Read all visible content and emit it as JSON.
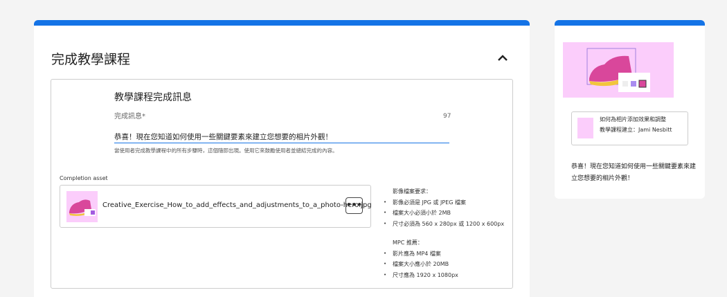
{
  "section": {
    "title": "完成教學課程"
  },
  "form": {
    "heading": "教學課程完成訊息",
    "label": "完成訊息*",
    "char_count": "97",
    "value": "恭喜！現在您知道如何使用一些關鍵要素來建立您想要的相片外觀！",
    "hint": "當使用者完成教學課程中的所有步驟時，這個隨即出現。使用它來鼓勵使用者並總結完成的內容。"
  },
  "asset": {
    "label": "Completion asset",
    "filename": "Creative_Exercise_How_to_add_effects_and_adjustments_to_a_photo-hero.jpg",
    "more_label": "•••"
  },
  "requirements": {
    "image_heading": "影像檔案要求：",
    "image_items": [
      "影像必須是 JPG 或 JPEG 檔案",
      "檔案大小必須小於 2MB",
      "尺寸必須為 560 x 280px 或 1200 x 600px"
    ],
    "mpc_heading": "MPC 推薦：",
    "mpc_items": [
      "影片應為 MP4 檔案",
      "檔案大小應小於 20MB",
      "尺寸應為 1920 x 1080px"
    ]
  },
  "preview": {
    "title": "如何為相片添加效果和調整",
    "author": "教學課程建立：Jami Nesbitt",
    "message": "恭喜！現在您知道如何使用一些關鍵要素來建立您想要的相片外觀！"
  },
  "colors": {
    "accent": "#1473e6",
    "thumb_bg": "#fbcdfb"
  }
}
